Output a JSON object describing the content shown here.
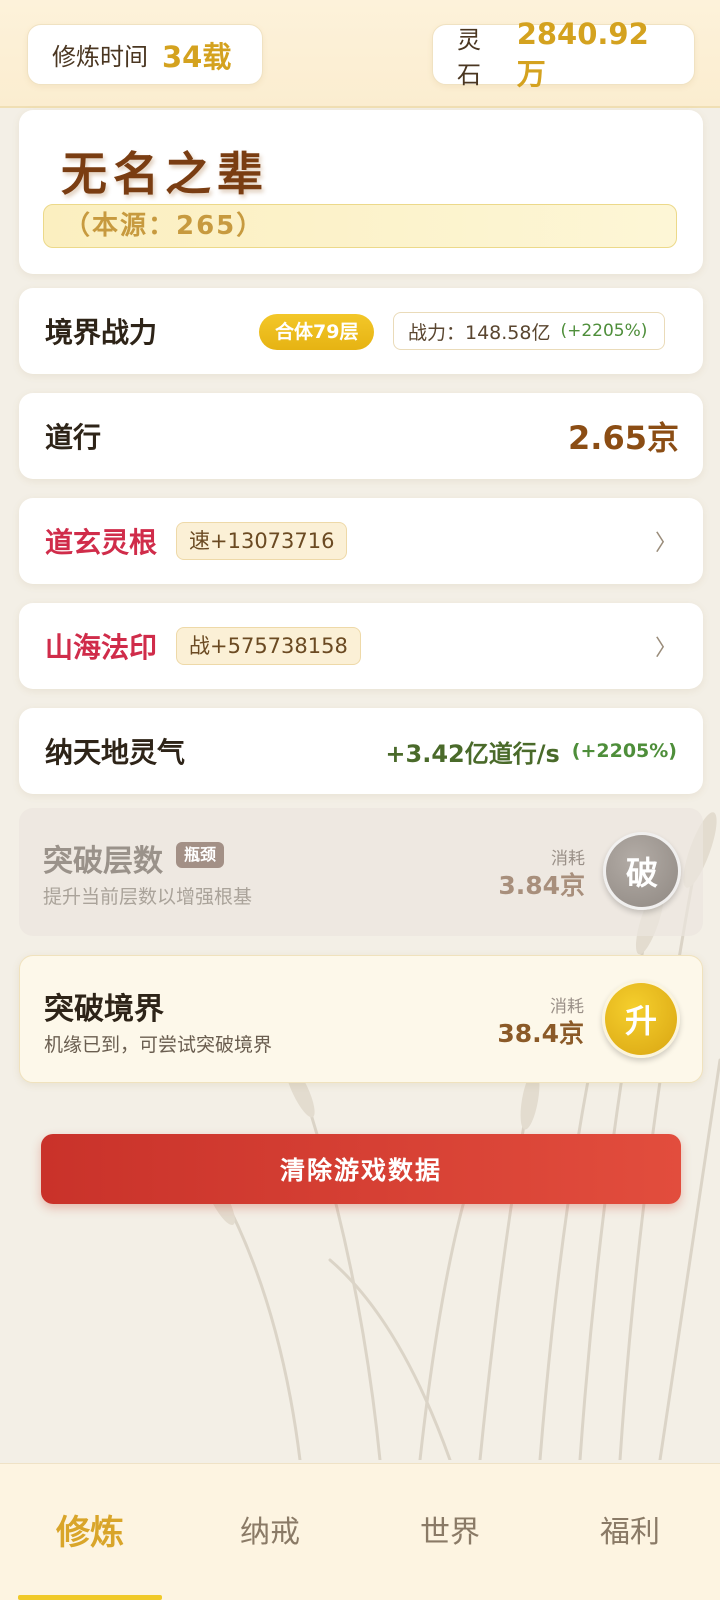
{
  "header": {
    "time_label": "修炼时间",
    "time_value": "34载",
    "stone_label": "灵石",
    "stone_value": "2840.92万"
  },
  "character": {
    "name": "无名之辈",
    "source": "（本源：265）"
  },
  "realm": {
    "label": "境界战力",
    "level_badge": "合体79层",
    "power": "战力：148.58亿",
    "power_gain": "(+2205%)"
  },
  "dao": {
    "label": "道行",
    "value": "2.65京"
  },
  "root": {
    "label": "道玄灵根",
    "tag": "速+13073716",
    "chevron": "〉"
  },
  "seal": {
    "label": "山海法印",
    "tag": "战+575738158",
    "chevron": "〉"
  },
  "qi": {
    "label": "纳天地灵气",
    "rate": "+3.42亿道行/s",
    "gain": "(+2205%)"
  },
  "breakthrough_layers": {
    "title": "突破层数",
    "badge": "瓶颈",
    "desc": "提升当前层数以增强根基",
    "cost_label": "消耗",
    "cost_value": "3.84京",
    "button": "破"
  },
  "breakthrough_realm": {
    "title": "突破境界",
    "desc": "机缘已到，可尝试突破境界",
    "cost_label": "消耗",
    "cost_value": "38.4京",
    "button": "升"
  },
  "clear_button": "清除游戏数据",
  "tabs": [
    {
      "label": "修炼",
      "active": true
    },
    {
      "label": "纳戒",
      "active": false
    },
    {
      "label": "世界",
      "active": false
    },
    {
      "label": "福利",
      "active": false
    }
  ],
  "colors": {
    "gold": "#d4a21f",
    "red_label": "#d02c4a",
    "green_gain": "#4e8e3a",
    "clear_button": "#d63a2f"
  }
}
